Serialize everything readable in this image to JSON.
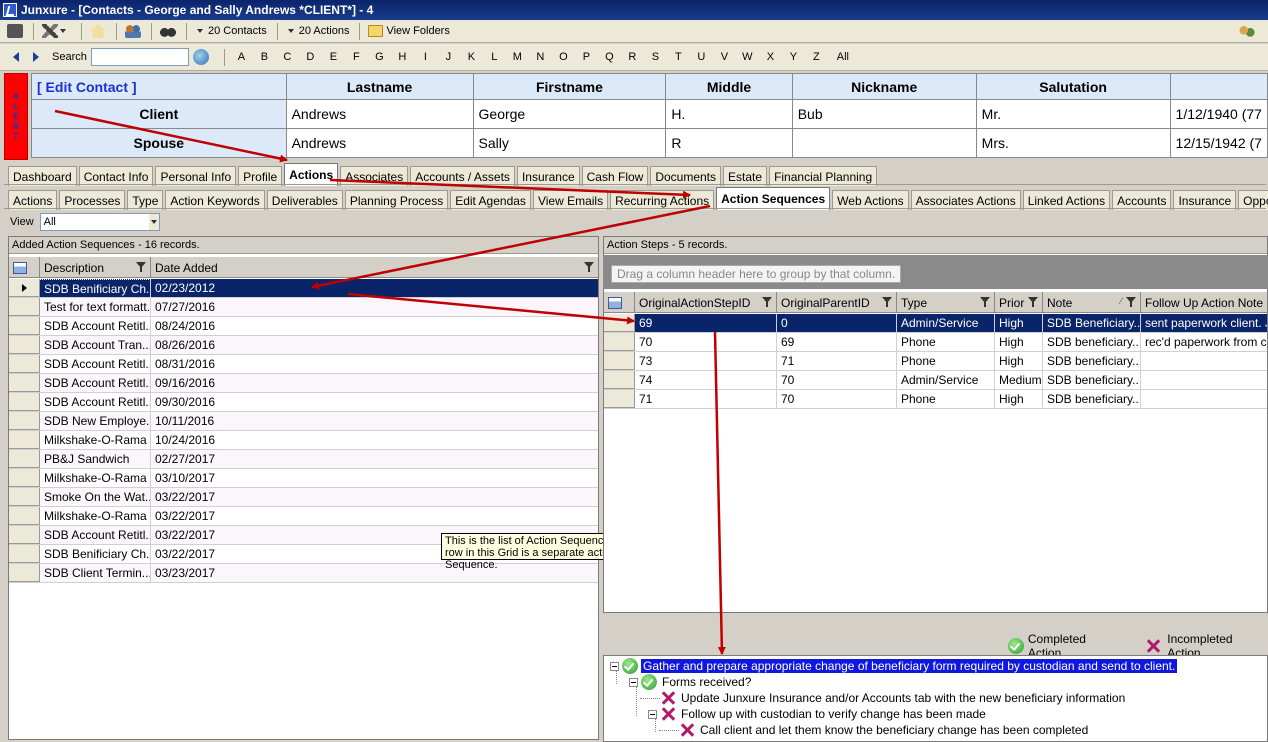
{
  "window": {
    "title": "Junxure - [Contacts - George and Sally Andrews  *CLIENT*] - 4"
  },
  "toolbar": {
    "contacts_label": "20 Contacts",
    "actions_label": "20 Actions",
    "view_folders_label": "View Folders"
  },
  "nav": {
    "search_label": "Search",
    "letters": [
      "A",
      "B",
      "C",
      "D",
      "E",
      "F",
      "G",
      "H",
      "I",
      "J",
      "K",
      "L",
      "M",
      "N",
      "O",
      "P",
      "Q",
      "R",
      "S",
      "T",
      "U",
      "V",
      "W",
      "X",
      "Y",
      "Z",
      "All"
    ]
  },
  "alert": {
    "label": "ALERT"
  },
  "contact": {
    "edit_label": "[ Edit Contact ]",
    "headers": [
      "Lastname",
      "Firstname",
      "Middle",
      "Nickname",
      "Salutation",
      ""
    ],
    "rows": [
      {
        "role": "Client",
        "lastname": "Andrews",
        "firstname": "George",
        "middle": "H.",
        "nickname": "Bub",
        "salutation": "Mr.",
        "dob": "1/12/1940 (77"
      },
      {
        "role": "Spouse",
        "lastname": "Andrews",
        "firstname": "Sally",
        "middle": "R",
        "nickname": "",
        "salutation": "Mrs.",
        "dob": "12/15/1942 (7"
      }
    ]
  },
  "main_tabs": [
    "Dashboard",
    "Contact Info",
    "Personal Info",
    "Profile",
    "Actions",
    "Associates",
    "Accounts / Assets",
    "Insurance",
    "Cash Flow",
    "Documents",
    "Estate",
    "Financial Planning"
  ],
  "main_tabs_active": "Actions",
  "sub_tabs": [
    "Actions",
    "Processes",
    "Type",
    "Action Keywords",
    "Deliverables",
    "Planning Process",
    "Edit Agendas",
    "View Emails",
    "Recurring Actions",
    "Action Sequences",
    "Web Actions",
    "Associates Actions",
    "Linked Actions",
    "Accounts",
    "Insurance",
    "Opportunities"
  ],
  "sub_tabs_active": "Action Sequences",
  "view": {
    "label": "View",
    "value": "All"
  },
  "sequences": {
    "caption": "Added Action Sequences - 16 records.",
    "columns": [
      "Description",
      "Date Added"
    ],
    "rows": [
      [
        "SDB Benificiary Ch...",
        "02/23/2012"
      ],
      [
        "Test for text formatt...",
        "07/27/2016"
      ],
      [
        "SDB Account Retitl...",
        "08/24/2016"
      ],
      [
        "SDB Account Tran...",
        "08/26/2016"
      ],
      [
        "SDB Account Retitl...",
        "08/31/2016"
      ],
      [
        "SDB Account Retitl...",
        "09/16/2016"
      ],
      [
        "SDB Account Retitl...",
        "09/30/2016"
      ],
      [
        "SDB New Employe...",
        "10/11/2016"
      ],
      [
        "Milkshake-O-Rama",
        "10/24/2016"
      ],
      [
        "PB&J Sandwich",
        "02/27/2017"
      ],
      [
        "Milkshake-O-Rama",
        "03/10/2017"
      ],
      [
        "Smoke On the Wat...",
        "03/22/2017"
      ],
      [
        "Milkshake-O-Rama",
        "03/22/2017"
      ],
      [
        "SDB Account Retitl...",
        "03/22/2017"
      ],
      [
        "SDB Benificiary Ch...",
        "03/22/2017"
      ],
      [
        "SDB Client Termin...",
        "03/23/2017"
      ]
    ]
  },
  "steps": {
    "caption": "Action Steps - 5 records.",
    "group_hint": "Drag a column header here to group by that column.",
    "columns": [
      "OriginalActionStepID",
      "OriginalParentID",
      "Type",
      "Prior",
      "Note",
      "Follow Up Action Note"
    ],
    "rows": [
      [
        "69",
        "0",
        "Admin/Service",
        "High",
        "SDB Beneficiary...",
        "sent paperwork client.  J"
      ],
      [
        "70",
        "69",
        "Phone",
        "High",
        "SDB beneficiary...",
        "rec'd paperwork from cli"
      ],
      [
        "73",
        "71",
        "Phone",
        "High",
        "SDB beneficiary...",
        ""
      ],
      [
        "74",
        "70",
        "Admin/Service",
        "Medium",
        "SDB beneficiary...",
        ""
      ],
      [
        "71",
        "70",
        "Phone",
        "High",
        "SDB beneficiary...",
        ""
      ]
    ]
  },
  "legend": {
    "completed": "Completed Action",
    "incompleted": "Incompleted Action"
  },
  "tree": [
    "Gather and prepare appropriate change of beneficiary form required by custodian and send to client.",
    "Forms received?",
    "Update Junxure Insurance and/or Accounts tab with the new beneficiary information",
    "Follow up with custodian to verify change has been made",
    "Call client and let them know the beneficiary change has been completed"
  ],
  "tooltip": {
    "text": "This is the list of Action Sequences.  Each row in this Grid is a separate action Sequence."
  },
  "colors": {
    "arrow": "#c00000",
    "selection": "#0a246a",
    "tree_highlight": "#1018e0",
    "header_bg": "#dce9f9"
  }
}
